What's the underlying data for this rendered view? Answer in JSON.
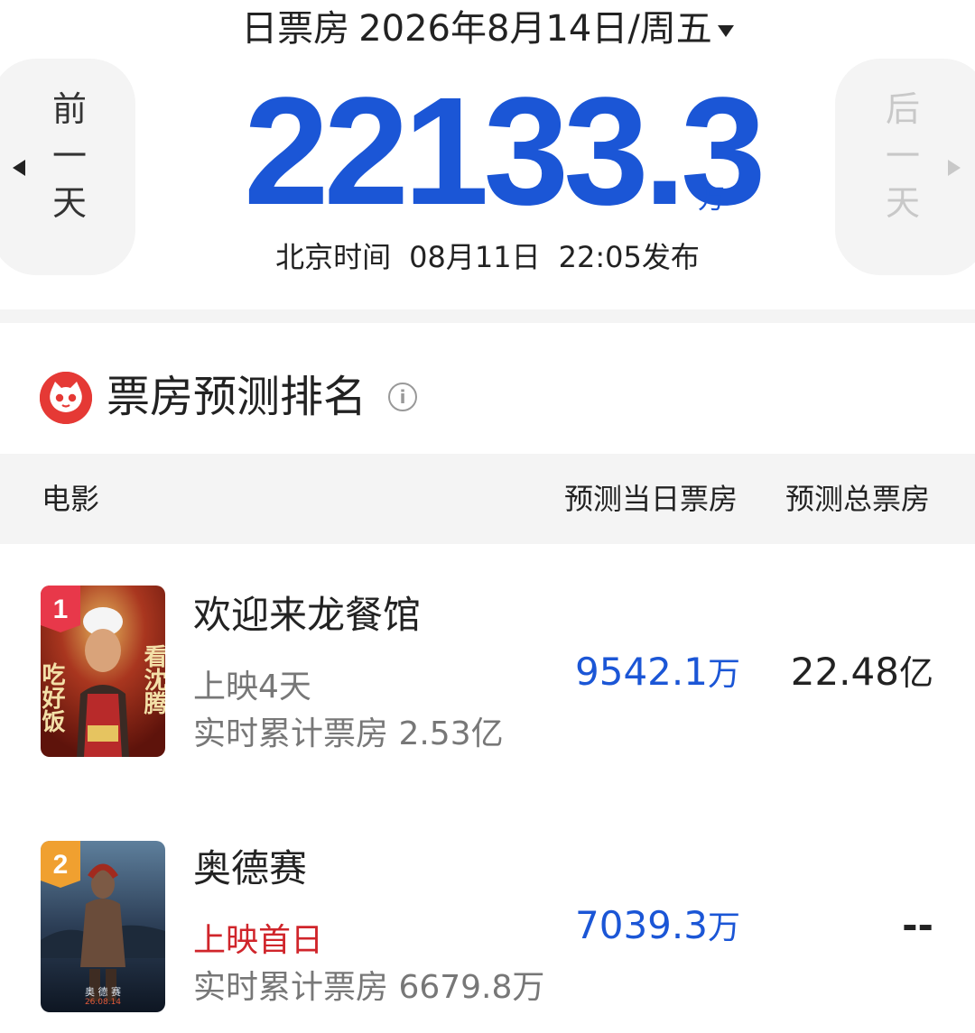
{
  "header": {
    "label": "日票房",
    "date": "2026年8月14日/周五",
    "prev_day": [
      "前",
      "一",
      "天"
    ],
    "next_day": [
      "后",
      "一",
      "天"
    ]
  },
  "total": {
    "value": "22133.3",
    "unit": "万",
    "publish_prefix": "北京时间",
    "publish_date": "08月11日",
    "publish_time": "22:05发布"
  },
  "section": {
    "title": "票房预测排名",
    "info_icon": "info-icon"
  },
  "table": {
    "col_movie": "电影",
    "col_day": "预测当日票房",
    "col_total": "预测总票房"
  },
  "movies": [
    {
      "rank": "1",
      "name": "欢迎来龙餐馆",
      "days": "上映4天",
      "cumulative": "实时累计票房 2.53亿",
      "pred_day": "9542.1",
      "pred_day_unit": "万",
      "pred_total": "22.48",
      "pred_total_unit": "亿",
      "poster_left_text": "吃好饭",
      "poster_right_text": "看沈腾"
    },
    {
      "rank": "2",
      "name": "奥德赛",
      "days": "上映首日",
      "cumulative": "实时累计票房 6679.8万",
      "pred_day": "7039.3",
      "pred_day_unit": "万",
      "pred_total": "--",
      "poster_caption": "奥 德 赛",
      "poster_date": "26.08.14"
    }
  ],
  "colors": {
    "accent_blue": "#1b56d6",
    "red_status": "#d0252b",
    "rank1": "#e8384a",
    "rank2": "#f0a030"
  }
}
